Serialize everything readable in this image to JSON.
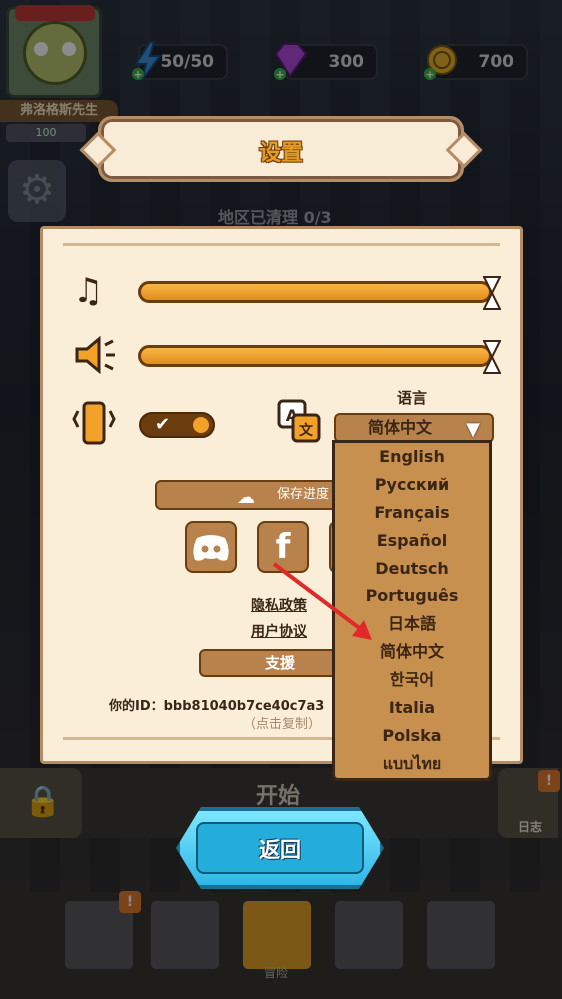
{
  "hud": {
    "player_name": "弗洛格斯先生",
    "player_level": "100",
    "energy": "50/50",
    "gems": "300",
    "coins": "700",
    "region_status": "地区已清理 0/3"
  },
  "dialog": {
    "title": "设置",
    "language_label": "语言",
    "language_selected": "简体中文",
    "save_progress": "保存进度",
    "privacy_policy": "隐私政策",
    "user_agreement": "用户协议",
    "support": "支援",
    "your_id": "你的ID：bbb81040b7ce40c7a3",
    "tap_to_copy": "（点击复制）",
    "social": {
      "discord_icon": "discord-icon",
      "facebook_label": "f"
    }
  },
  "language_options": [
    "English",
    "Русский",
    "Français",
    "Español",
    "Deutsch",
    "Português",
    "日本語",
    "简体中文",
    "한국어",
    "Italia",
    "Polska",
    "แบบไทย"
  ],
  "bottom": {
    "start": "开始",
    "back": "返回",
    "log": "日志",
    "adventure": "冒险",
    "badge": "!"
  },
  "colors": {
    "panel_bg": "#fbeed9",
    "panel_border": "#b58c64",
    "button_brown": "#b8824d",
    "slider_orange": "#f2a129",
    "title_orange": "#e59b21",
    "back_cyan": "#2fb6e6",
    "arrow_red": "#e02a2a"
  },
  "settings": {
    "music_volume": 1.0,
    "sound_volume": 1.0,
    "vibration_enabled": true
  }
}
